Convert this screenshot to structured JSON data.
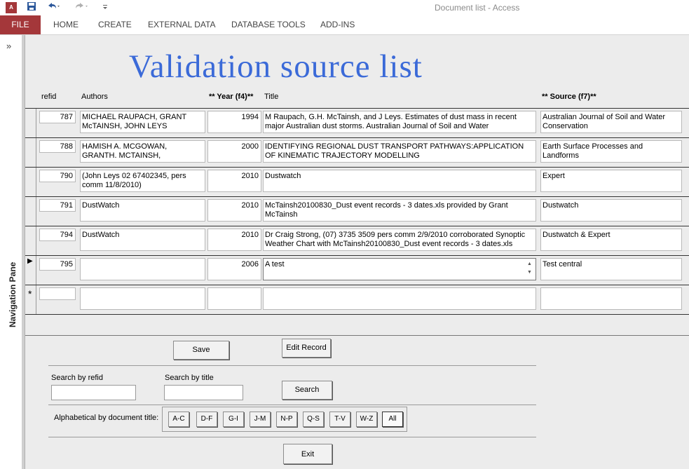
{
  "window": {
    "app_icon": "A",
    "title": "Document list - Access",
    "quick_access": {
      "save_icon": "save-icon",
      "undo_icon": "undo-icon",
      "redo_icon": "redo-icon",
      "customize_icon": "dropdown-icon"
    }
  },
  "ribbon": {
    "tabs": [
      "FILE",
      "HOME",
      "CREATE",
      "EXTERNAL DATA",
      "DATABASE TOOLS",
      "ADD-INS"
    ]
  },
  "nav_pane": {
    "toggle": "»",
    "label": "Navigation Pane"
  },
  "form": {
    "title": "Validation source list",
    "headers": {
      "refid": "refid",
      "authors": "Authors",
      "year": "** Year (f4)**",
      "title": "Title",
      "source": "** Source (f7)**"
    },
    "records": [
      {
        "refid": "787",
        "authors": "MICHAEL RAUPACH, GRANT McTAINSH, JOHN LEYS",
        "year": "1994",
        "title": "M Raupach, G.H. McTainsh, and J Leys. Estimates of dust mass in recent major Australian dust storms. Australian Journal of Soil and Water",
        "source": "Australian Journal of Soil and Water Conservation"
      },
      {
        "refid": "788",
        "authors": "HAMISH A. MCGOWAN, GRANTH. MCTAINSH,",
        "year": "2000",
        "title": "IDENTIFYING REGIONAL DUST TRANSPORT PATHWAYS:APPLICATION OF KINEMATIC TRAJECTORY MODELLING",
        "source": "Earth Surface Processes and Landforms"
      },
      {
        "refid": "790",
        "authors": " (John Leys 02 67402345, pers comm 11/8/2010)",
        "year": "2010",
        "title": "Dustwatch",
        "source": "Expert"
      },
      {
        "refid": "791",
        "authors": "DustWatch",
        "year": "2010",
        "title": "McTainsh20100830_Dust event records - 3 dates.xls provided by Grant McTainsh",
        "source": "Dustwatch"
      },
      {
        "refid": "794",
        "authors": "DustWatch",
        "year": "2010",
        "title": "Dr Craig Strong, (07) 3735 3509 pers comm 2/9/2010 corroborated Synoptic Weather Chart with McTainsh20100830_Dust event records - 3 dates.xls",
        "source": "Dustwatch & Expert"
      },
      {
        "refid": "795",
        "authors": "",
        "year": "2006",
        "title": "A test",
        "source": "Test central"
      }
    ],
    "current_record_marker": "▶",
    "new_record_marker": "*",
    "buttons": {
      "save": "Save",
      "edit_record": "Edit Record",
      "search": "Search",
      "exit": "Exit"
    },
    "search": {
      "refid_label": "Search by refid",
      "title_label": "Search by title",
      "refid_value": "",
      "title_value": ""
    },
    "alphabetical": {
      "label": "Alphabetical by document title:",
      "buttons": [
        "A-C",
        "D-F",
        "G-I",
        "J-M",
        "N-P",
        "Q-S",
        "T-V",
        "W-Z",
        "All"
      ],
      "active": "All"
    }
  }
}
